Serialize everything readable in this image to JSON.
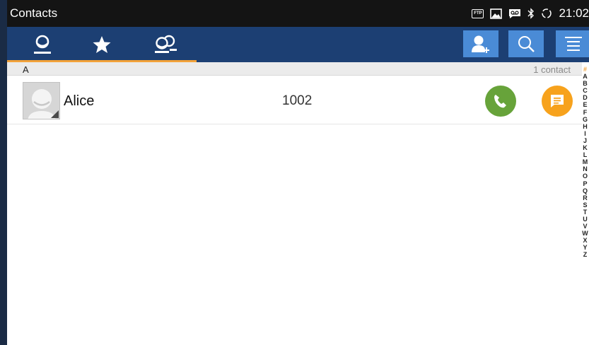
{
  "status_bar": {
    "title": "Contacts",
    "ftp_label": "FTP",
    "time": "21:02",
    "icons": [
      "ftp-icon",
      "image-icon",
      "voicemail-icon",
      "bluetooth-icon",
      "sync-icon"
    ]
  },
  "toolbar": {
    "tabs": [
      {
        "icon": "person-icon"
      },
      {
        "icon": "star-icon"
      },
      {
        "icon": "group-icon"
      }
    ],
    "active_tab": 0,
    "accent_color": "#f2a23a",
    "buttons": [
      "add-contact-icon",
      "search-icon",
      "menu-icon"
    ]
  },
  "list": {
    "section_letter": "A",
    "count": "1 contact",
    "contacts": [
      {
        "name": "Alice",
        "number": "1002"
      }
    ]
  },
  "alpha_index": [
    "#",
    "A",
    "B",
    "C",
    "D",
    "E",
    "F",
    "G",
    "H",
    "I",
    "J",
    "K",
    "L",
    "M",
    "N",
    "O",
    "P",
    "Q",
    "R",
    "S",
    "T",
    "U",
    "V",
    "W",
    "X",
    "Y",
    "Z"
  ],
  "colors": {
    "toolbar": "#1c3f73",
    "toolbar_button": "#4a8bd6",
    "call": "#67a33a",
    "message": "#f7a21c"
  }
}
